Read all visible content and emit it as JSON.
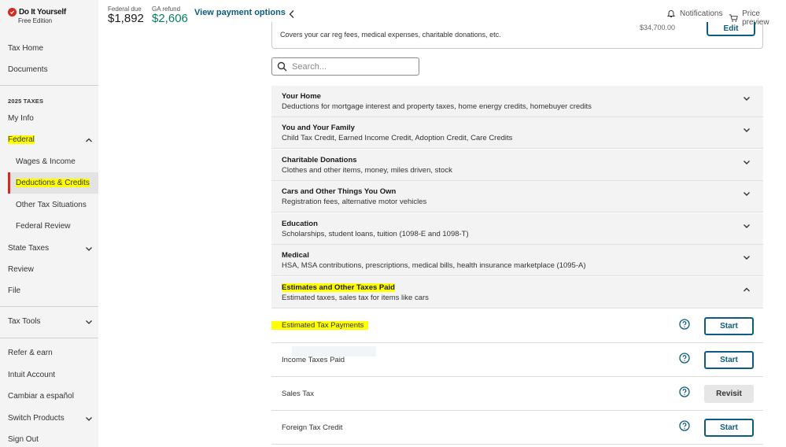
{
  "brand": {
    "name": "Do It Yourself",
    "edition": "Free Edition",
    "accent": "#d52b1e"
  },
  "sidebar": {
    "tax_home": "Tax Home",
    "documents": "Documents",
    "section_heading": "2025 TAXES",
    "my_info": "My Info",
    "federal": "Federal",
    "wages_income": "Wages & Income",
    "deductions_credits": "Deductions & Credits",
    "other_tax_situations": "Other Tax Situations",
    "federal_review": "Federal Review",
    "state_taxes": "State Taxes",
    "review": "Review",
    "file": "File",
    "tax_tools": "Tax Tools",
    "refer_earn": "Refer & earn",
    "intuit_account": "Intuit Account",
    "cambiar": "Cambiar a español",
    "switch_products": "Switch Products",
    "sign_out": "Sign Out"
  },
  "header": {
    "federal_label": "Federal due",
    "federal_amount": "$1,892",
    "state_label": "GA refund",
    "state_amount": "$2,606",
    "payment_link": "View payment options",
    "notifications": "Notifications",
    "price_preview": "Price preview"
  },
  "top_card": {
    "description": "Covers your car reg fees, medical expenses, charitable donations, etc.",
    "amount": "$34,700.00",
    "edit_label": "Edit"
  },
  "search": {
    "placeholder": "Search..."
  },
  "categories": [
    {
      "title": "Your Home",
      "desc": "Deductions for mortgage interest and property taxes, home energy credits, homebuyer credits"
    },
    {
      "title": "You and Your Family",
      "desc": "Child Tax Credit, Earned Income Credit, Adoption Credit, Care Credits"
    },
    {
      "title": "Charitable Donations",
      "desc": "Clothes and other items, money, miles driven, stock"
    },
    {
      "title": "Cars and Other Things You Own",
      "desc": "Registration fees, alternative motor vehicles"
    },
    {
      "title": "Education",
      "desc": "Scholarships, student loans, tuition (1098-E and 1098-T)"
    },
    {
      "title": "Medical",
      "desc": "HSA, MSA contributions, prescriptions, medical bills, health insurance marketplace (1095-A)"
    },
    {
      "title": "Estimates and Other Taxes Paid",
      "desc": "Estimated taxes, sales tax for items like cars"
    }
  ],
  "items": [
    {
      "label": "Estimated Tax Payments",
      "action": "Start"
    },
    {
      "label": "Income Taxes Paid",
      "action": "Start"
    },
    {
      "label": "Sales Tax",
      "action": "Revisit"
    },
    {
      "label": "Foreign Tax Credit",
      "action": "Start"
    }
  ],
  "colors": {
    "link": "#0b5c7d",
    "refund": "#0a7d63",
    "highlight": "#ffff00"
  }
}
